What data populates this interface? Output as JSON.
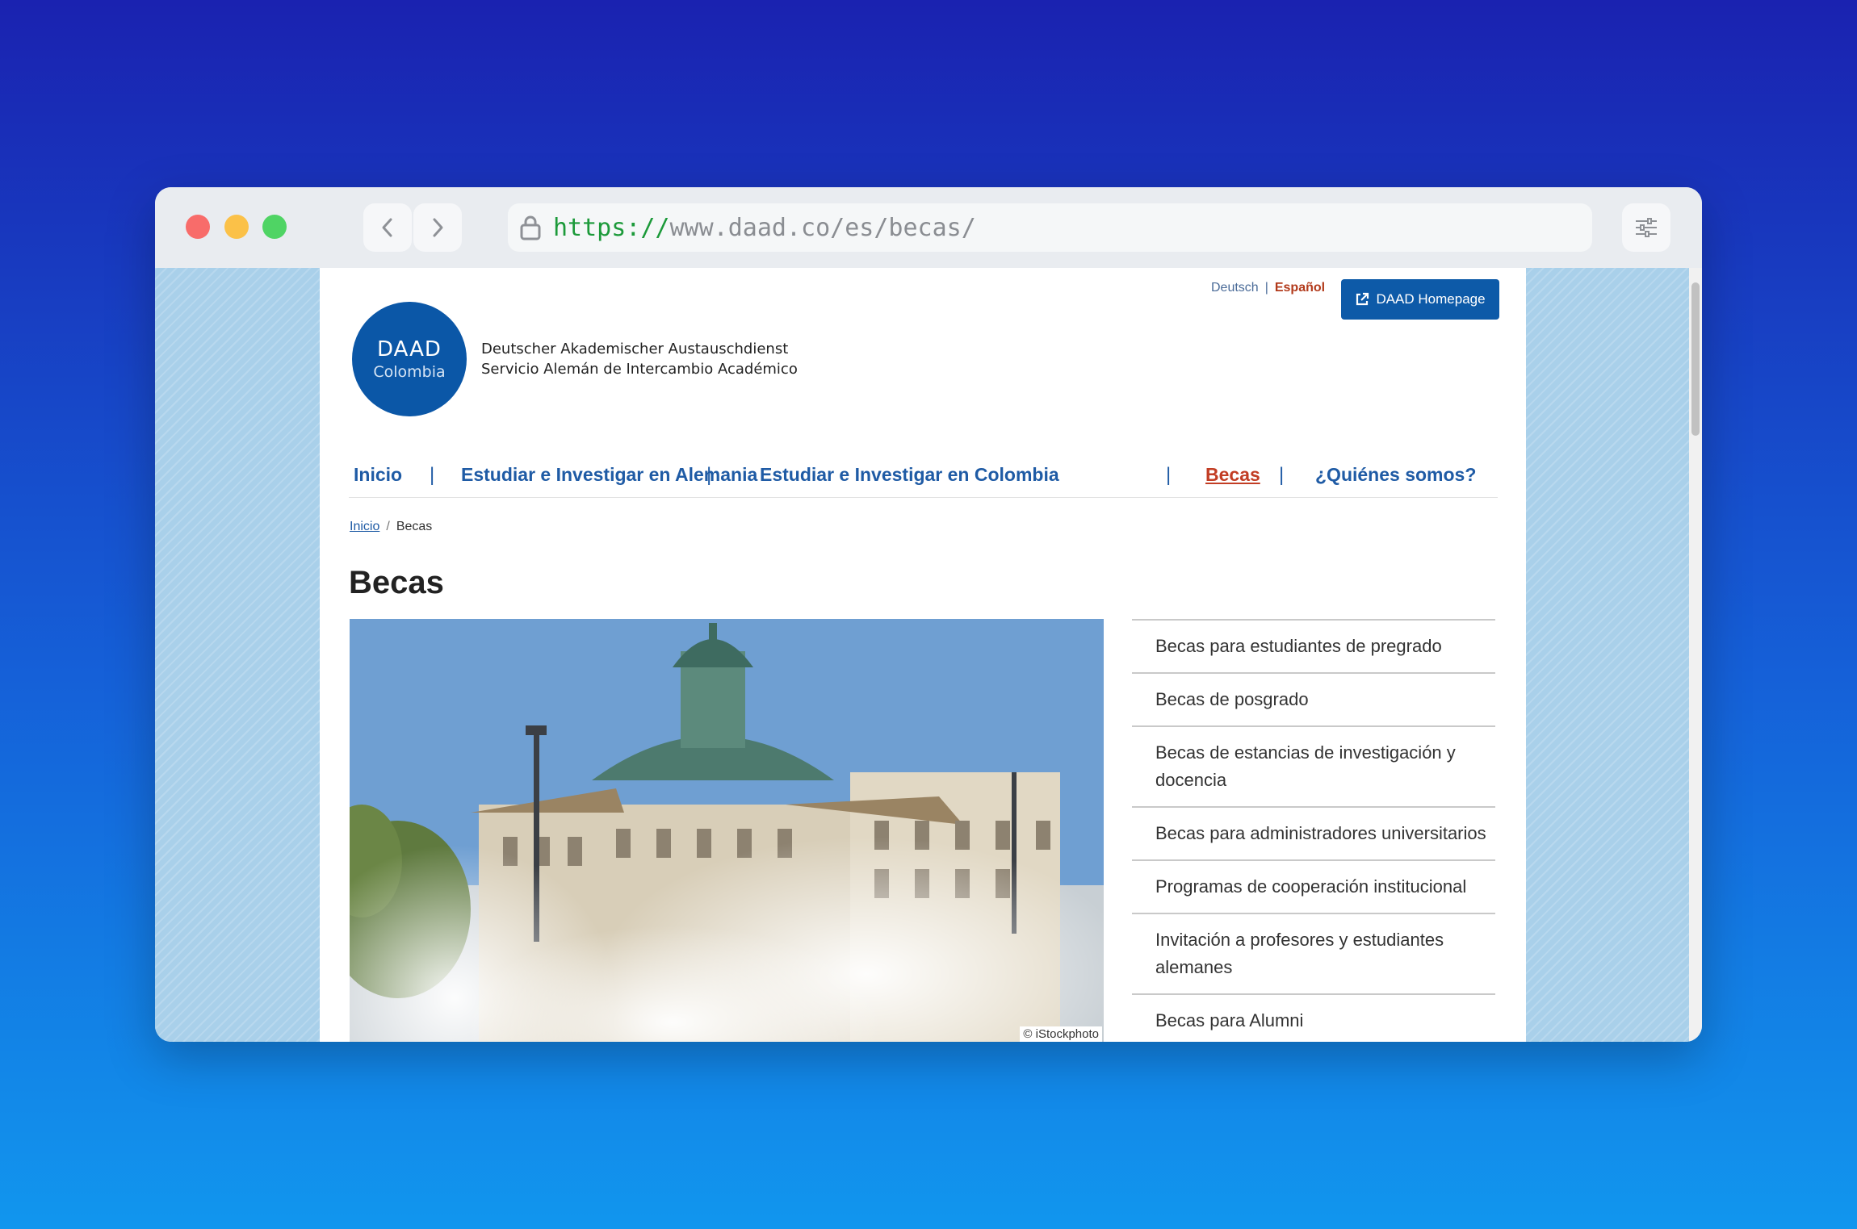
{
  "browser": {
    "url_scheme": "https://",
    "url_rest": "www.daad.co/es/becas/"
  },
  "header": {
    "lang_de": "Deutsch",
    "lang_sep": "|",
    "lang_es": "Español",
    "home_button": "DAAD Homepage",
    "logo_line1": "DAAD",
    "logo_line2": "Colombia",
    "org_line1": "Deutscher Akademischer Austauschdienst",
    "org_line2": "Servicio Alemán de Intercambio Académico"
  },
  "nav": {
    "items": [
      {
        "label": "Inicio"
      },
      {
        "label": "Estudiar e Investigar en Alemania"
      },
      {
        "label": "Estudiar e Investigar en Colombia"
      },
      {
        "label": "Becas",
        "active": true
      },
      {
        "label": "¿Quiénes somos?"
      }
    ],
    "separator": "|"
  },
  "breadcrumb": {
    "home": "Inicio",
    "sep": "/",
    "current": "Becas"
  },
  "page": {
    "title": "Becas",
    "image_credit": "© iStockphoto"
  },
  "sidemenu": {
    "items": [
      "Becas para estudiantes de pregrado",
      "Becas de posgrado",
      "Becas de estancias de investigación y docencia",
      "Becas para administradores universitarios",
      "Programas de cooperación institucional",
      "Invitación a profesores y estudiantes alemanes",
      "Becas para Alumni"
    ]
  },
  "colors": {
    "brand_blue": "#0b57a7",
    "nav_blue": "#1f5ba5",
    "active_red": "#c23d24"
  }
}
